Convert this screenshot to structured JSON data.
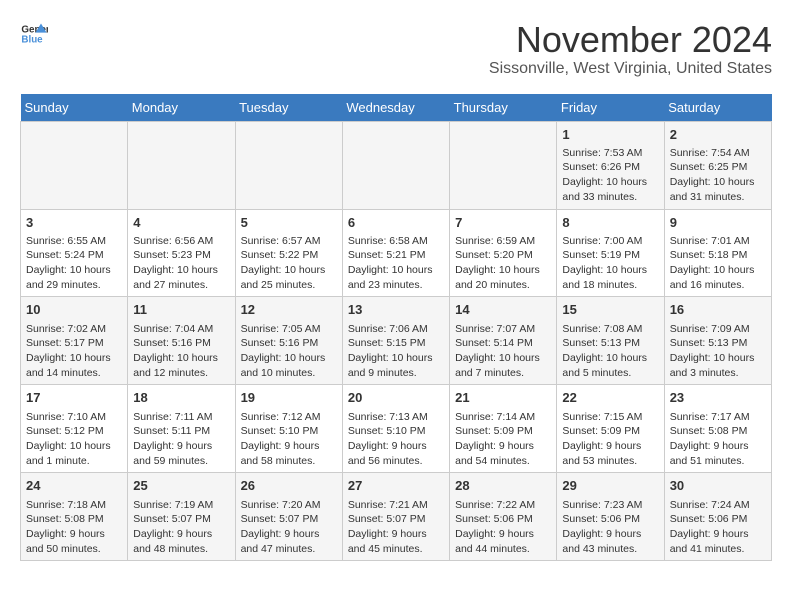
{
  "header": {
    "logo_line1": "General",
    "logo_line2": "Blue",
    "title": "November 2024",
    "subtitle": "Sissonville, West Virginia, United States"
  },
  "days_of_week": [
    "Sunday",
    "Monday",
    "Tuesday",
    "Wednesday",
    "Thursday",
    "Friday",
    "Saturday"
  ],
  "weeks": [
    [
      {
        "day": "",
        "info": ""
      },
      {
        "day": "",
        "info": ""
      },
      {
        "day": "",
        "info": ""
      },
      {
        "day": "",
        "info": ""
      },
      {
        "day": "",
        "info": ""
      },
      {
        "day": "1",
        "info": "Sunrise: 7:53 AM\nSunset: 6:26 PM\nDaylight: 10 hours and 33 minutes."
      },
      {
        "day": "2",
        "info": "Sunrise: 7:54 AM\nSunset: 6:25 PM\nDaylight: 10 hours and 31 minutes."
      }
    ],
    [
      {
        "day": "3",
        "info": "Sunrise: 6:55 AM\nSunset: 5:24 PM\nDaylight: 10 hours and 29 minutes."
      },
      {
        "day": "4",
        "info": "Sunrise: 6:56 AM\nSunset: 5:23 PM\nDaylight: 10 hours and 27 minutes."
      },
      {
        "day": "5",
        "info": "Sunrise: 6:57 AM\nSunset: 5:22 PM\nDaylight: 10 hours and 25 minutes."
      },
      {
        "day": "6",
        "info": "Sunrise: 6:58 AM\nSunset: 5:21 PM\nDaylight: 10 hours and 23 minutes."
      },
      {
        "day": "7",
        "info": "Sunrise: 6:59 AM\nSunset: 5:20 PM\nDaylight: 10 hours and 20 minutes."
      },
      {
        "day": "8",
        "info": "Sunrise: 7:00 AM\nSunset: 5:19 PM\nDaylight: 10 hours and 18 minutes."
      },
      {
        "day": "9",
        "info": "Sunrise: 7:01 AM\nSunset: 5:18 PM\nDaylight: 10 hours and 16 minutes."
      }
    ],
    [
      {
        "day": "10",
        "info": "Sunrise: 7:02 AM\nSunset: 5:17 PM\nDaylight: 10 hours and 14 minutes."
      },
      {
        "day": "11",
        "info": "Sunrise: 7:04 AM\nSunset: 5:16 PM\nDaylight: 10 hours and 12 minutes."
      },
      {
        "day": "12",
        "info": "Sunrise: 7:05 AM\nSunset: 5:16 PM\nDaylight: 10 hours and 10 minutes."
      },
      {
        "day": "13",
        "info": "Sunrise: 7:06 AM\nSunset: 5:15 PM\nDaylight: 10 hours and 9 minutes."
      },
      {
        "day": "14",
        "info": "Sunrise: 7:07 AM\nSunset: 5:14 PM\nDaylight: 10 hours and 7 minutes."
      },
      {
        "day": "15",
        "info": "Sunrise: 7:08 AM\nSunset: 5:13 PM\nDaylight: 10 hours and 5 minutes."
      },
      {
        "day": "16",
        "info": "Sunrise: 7:09 AM\nSunset: 5:13 PM\nDaylight: 10 hours and 3 minutes."
      }
    ],
    [
      {
        "day": "17",
        "info": "Sunrise: 7:10 AM\nSunset: 5:12 PM\nDaylight: 10 hours and 1 minute."
      },
      {
        "day": "18",
        "info": "Sunrise: 7:11 AM\nSunset: 5:11 PM\nDaylight: 9 hours and 59 minutes."
      },
      {
        "day": "19",
        "info": "Sunrise: 7:12 AM\nSunset: 5:10 PM\nDaylight: 9 hours and 58 minutes."
      },
      {
        "day": "20",
        "info": "Sunrise: 7:13 AM\nSunset: 5:10 PM\nDaylight: 9 hours and 56 minutes."
      },
      {
        "day": "21",
        "info": "Sunrise: 7:14 AM\nSunset: 5:09 PM\nDaylight: 9 hours and 54 minutes."
      },
      {
        "day": "22",
        "info": "Sunrise: 7:15 AM\nSunset: 5:09 PM\nDaylight: 9 hours and 53 minutes."
      },
      {
        "day": "23",
        "info": "Sunrise: 7:17 AM\nSunset: 5:08 PM\nDaylight: 9 hours and 51 minutes."
      }
    ],
    [
      {
        "day": "24",
        "info": "Sunrise: 7:18 AM\nSunset: 5:08 PM\nDaylight: 9 hours and 50 minutes."
      },
      {
        "day": "25",
        "info": "Sunrise: 7:19 AM\nSunset: 5:07 PM\nDaylight: 9 hours and 48 minutes."
      },
      {
        "day": "26",
        "info": "Sunrise: 7:20 AM\nSunset: 5:07 PM\nDaylight: 9 hours and 47 minutes."
      },
      {
        "day": "27",
        "info": "Sunrise: 7:21 AM\nSunset: 5:07 PM\nDaylight: 9 hours and 45 minutes."
      },
      {
        "day": "28",
        "info": "Sunrise: 7:22 AM\nSunset: 5:06 PM\nDaylight: 9 hours and 44 minutes."
      },
      {
        "day": "29",
        "info": "Sunrise: 7:23 AM\nSunset: 5:06 PM\nDaylight: 9 hours and 43 minutes."
      },
      {
        "day": "30",
        "info": "Sunrise: 7:24 AM\nSunset: 5:06 PM\nDaylight: 9 hours and 41 minutes."
      }
    ]
  ]
}
